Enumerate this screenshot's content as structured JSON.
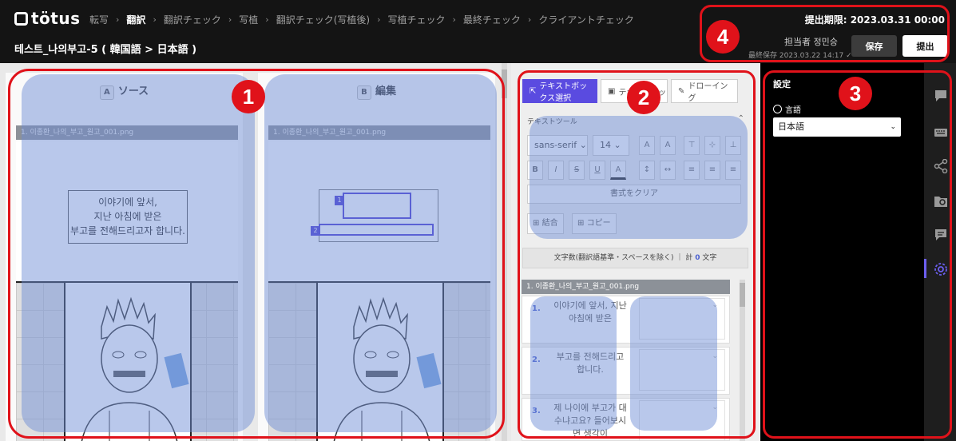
{
  "header": {
    "logo_text": "tötus",
    "steps": [
      {
        "label": "転写",
        "active": false
      },
      {
        "label": "翻訳",
        "active": true
      },
      {
        "label": "翻訳チェック",
        "active": false
      },
      {
        "label": "写植",
        "active": false
      },
      {
        "label": "翻訳チェック(写植後)",
        "active": false
      },
      {
        "label": "写植チェック",
        "active": false
      },
      {
        "label": "最終チェック",
        "active": false
      },
      {
        "label": "クライアントチェック",
        "active": false
      }
    ],
    "project_title": "테스트_나의부고-5 ( 韓国語 > 日本語 )",
    "deadline": "提出期限: 2023.03.31 00:00",
    "assignee": "担当者 정민승",
    "last_saved": "最終保存 2023.03.22 14:17",
    "save_label": "保存",
    "submit_label": "提出"
  },
  "work": {
    "source": {
      "badge": "A",
      "title": "ソース"
    },
    "edit": {
      "badge": "B",
      "title": "編集"
    },
    "file_name": "1. 이종환_나의_부고_원고_001.png",
    "caption_lines": [
      "이야기에 앞서,",
      "지난 아침에 받은",
      "부고를 전해드리고자 합니다."
    ],
    "box_numbers": [
      "1",
      "2"
    ]
  },
  "toolbar": {
    "tabs": [
      {
        "label": "テキストボックス選択",
        "active": true
      },
      {
        "label": "テキストボックス",
        "active": false
      },
      {
        "label": "ドローイング",
        "active": false
      }
    ],
    "section_title": "テキストツール",
    "font_family": "sans-serif",
    "font_size": "14",
    "clear_label": "書式をクリア",
    "merge_label": "結合",
    "copy_label": "コピー",
    "char_count_label": "文字数(翻訳語基準・スペースを除く)",
    "char_total_prefix": "計",
    "char_total": "0",
    "char_suffix": "文字"
  },
  "segments": {
    "file_name": "1. 이종환_나의_부고_원고_001.png",
    "items": [
      {
        "num": "1.",
        "text": "이야기에 앞서, 지난 아침에 받은"
      },
      {
        "num": "2.",
        "text": "부고를 전해드리고 합니다."
      },
      {
        "num": "3.",
        "text": "제 나이에 부고가 대수냐고요? 들어보시면 생각이"
      }
    ]
  },
  "settings": {
    "title": "設定",
    "language_label": "言語",
    "language_value": "日本語"
  },
  "annotations": {
    "labels": [
      "1",
      "2",
      "3",
      "4"
    ],
    "colors": {
      "red": "#e0121a",
      "highlight": "#6c8cd6",
      "accent": "#5a4be0"
    }
  },
  "icons": {
    "rail": [
      "comment-icon",
      "keyboard-icon",
      "share-icon",
      "folder-search-icon",
      "message-icon",
      "settings-gear-icon"
    ]
  }
}
